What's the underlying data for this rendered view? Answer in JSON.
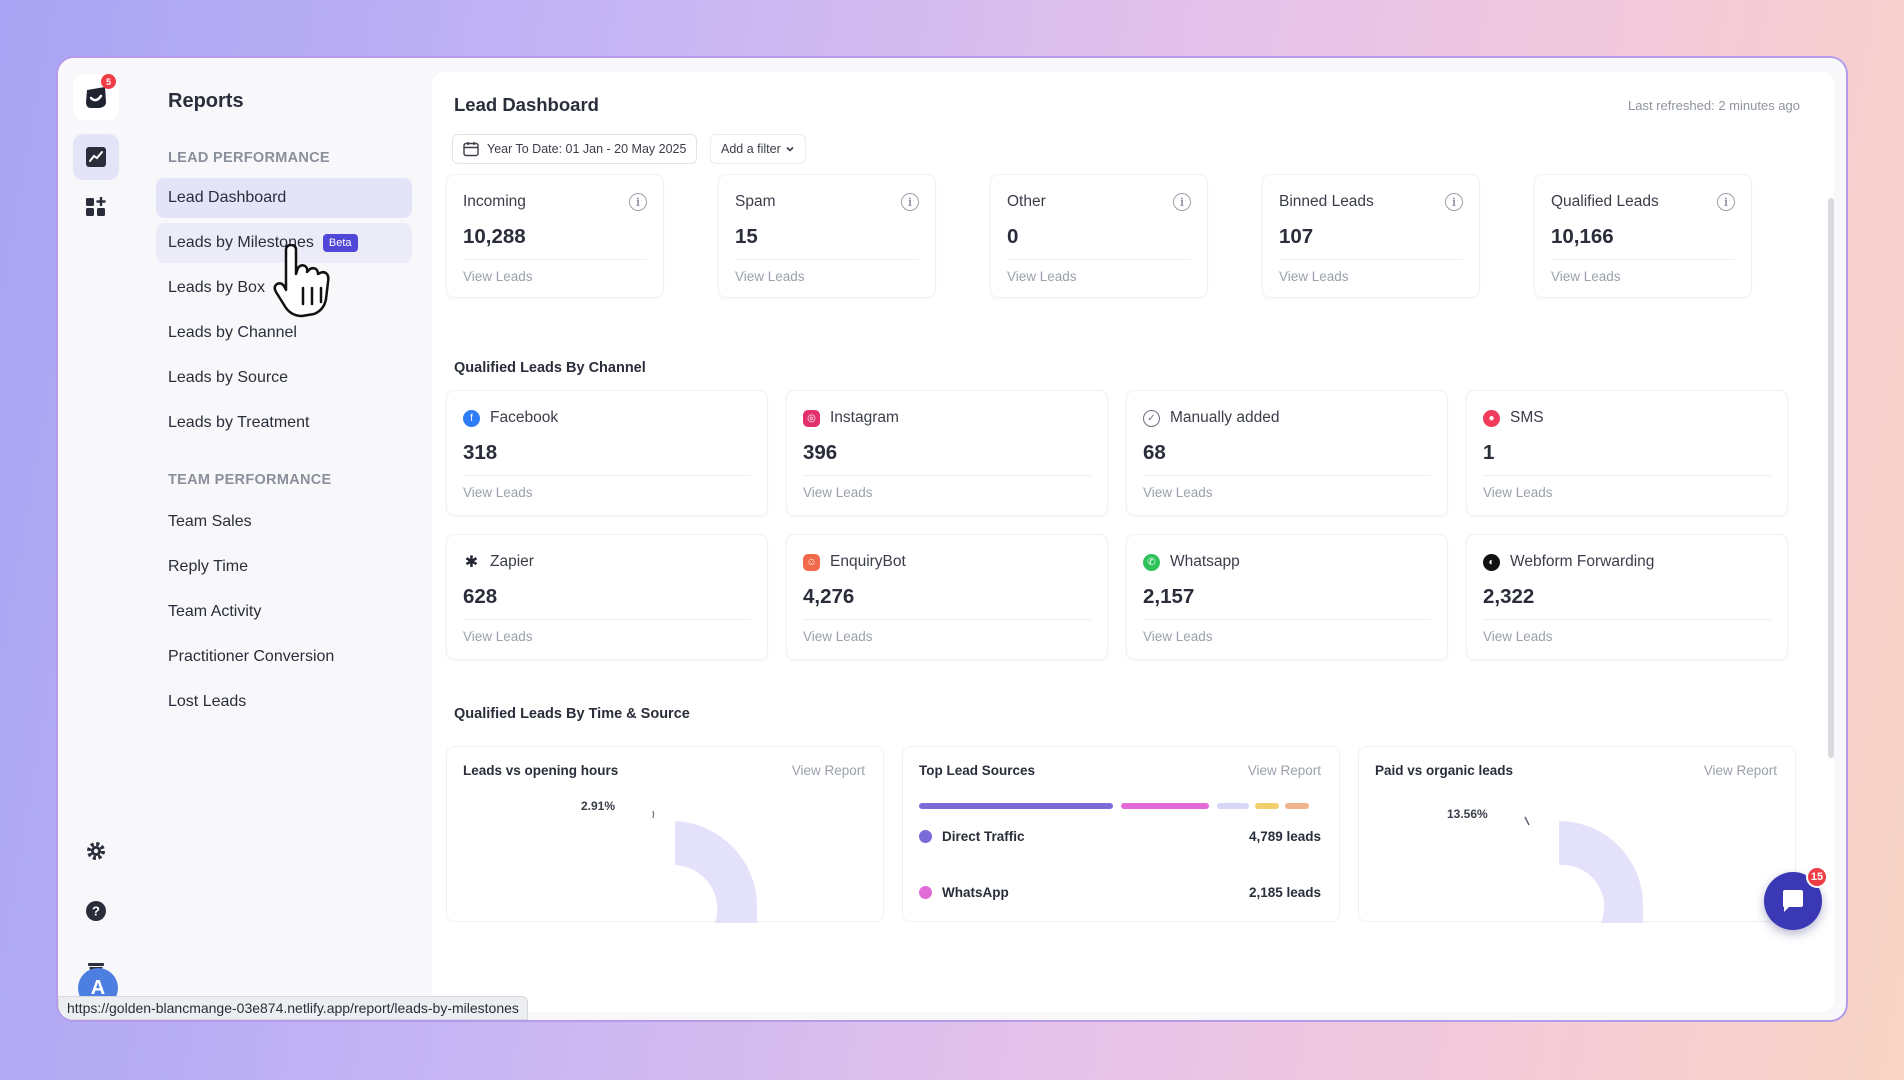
{
  "brand": {
    "notification_count": "5"
  },
  "sidebar": {
    "title": "Reports",
    "section_lead": "LEAD PERFORMANCE",
    "lead_items": [
      "Lead Dashboard",
      "Leads by Milestones",
      "Leads by Box",
      "Leads by Channel",
      "Leads by Source",
      "Leads by Treatment"
    ],
    "beta_label": "Beta",
    "section_team": "TEAM PERFORMANCE",
    "team_items": [
      "Team Sales",
      "Reply Time",
      "Team Activity",
      "Practitioner Conversion",
      "Lost Leads"
    ]
  },
  "user": {
    "initial": "A"
  },
  "header": {
    "title": "Lead Dashboard",
    "last_refreshed": "Last refreshed: 2 minutes ago",
    "date_range": "Year To Date: 01 Jan - 20 May 2025",
    "filter_label": "Add a filter"
  },
  "stats": [
    {
      "label": "Incoming",
      "value": "10,288",
      "link": "View Leads"
    },
    {
      "label": "Spam",
      "value": "15",
      "link": "View Leads"
    },
    {
      "label": "Other",
      "value": "0",
      "link": "View Leads"
    },
    {
      "label": "Binned Leads",
      "value": "107",
      "link": "View Leads"
    },
    {
      "label": "Qualified Leads",
      "value": "10,166",
      "link": "View Leads"
    }
  ],
  "channel_section_title": "Qualified Leads By Channel",
  "channels": [
    {
      "label": "Facebook",
      "value": "318",
      "link": "View Leads",
      "icon": "facebook-icon",
      "color": "#2f7df6"
    },
    {
      "label": "Instagram",
      "value": "396",
      "link": "View Leads",
      "icon": "instagram-icon",
      "color": "#e1306c"
    },
    {
      "label": "Manually added",
      "value": "68",
      "link": "View Leads",
      "icon": "check-circle-icon",
      "color": "#6b7280"
    },
    {
      "label": "SMS",
      "value": "1",
      "link": "View Leads",
      "icon": "sms-icon",
      "color": "#ef3c5a"
    },
    {
      "label": "Zapier",
      "value": "628",
      "link": "View Leads",
      "icon": "zapier-icon",
      "color": "#1f2430"
    },
    {
      "label": "EnquiryBot",
      "value": "4,276",
      "link": "View Leads",
      "icon": "enquirybot-icon",
      "color": "#f06a4b"
    },
    {
      "label": "Whatsapp",
      "value": "2,157",
      "link": "View Leads",
      "icon": "whatsapp-icon",
      "color": "#2fc25b"
    },
    {
      "label": "Webform Forwarding",
      "value": "2,322",
      "link": "View Leads",
      "icon": "webform-icon",
      "color": "#111111"
    }
  ],
  "time_section_title": "Qualified Leads By Time & Source",
  "panels": [
    {
      "title": "Leads vs opening hours",
      "link": "View Report",
      "percent": "2.91%"
    },
    {
      "title": "Top Lead Sources",
      "link": "View Report",
      "rows": [
        {
          "name": "Direct Traffic",
          "value": "4,789 leads",
          "color": "#7a6bd9"
        },
        {
          "name": "WhatsApp",
          "value": "2,185 leads",
          "color": "#e26bd8"
        }
      ]
    },
    {
      "title": "Paid vs organic leads",
      "link": "View Report",
      "percent": "13.56%"
    }
  ],
  "chat": {
    "badge": "15"
  },
  "status_url": "https://golden-blancmange-03e874.netlify.app/report/leads-by-milestones"
}
